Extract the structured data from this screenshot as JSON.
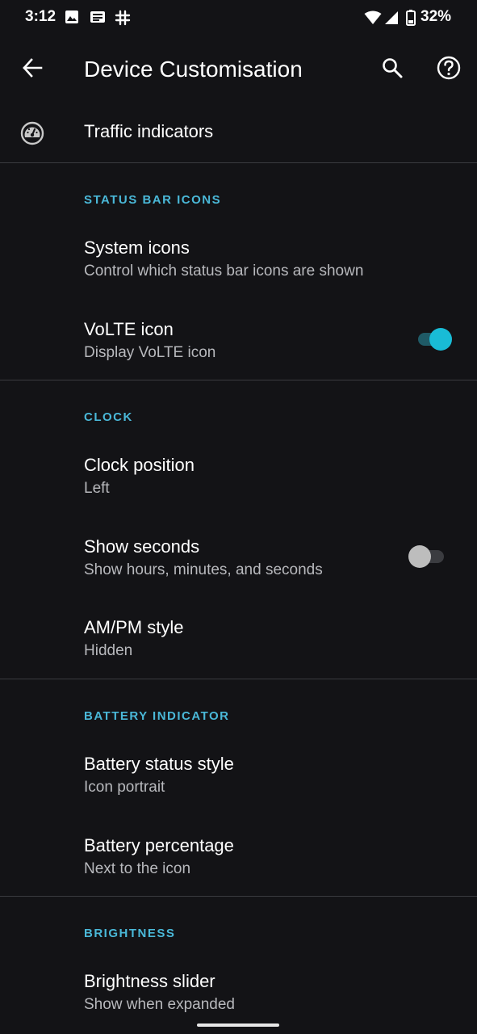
{
  "status_bar": {
    "time": "3:12",
    "left_icons": [
      "image-icon",
      "news-icon",
      "slack-icon"
    ],
    "right_icons": [
      "wifi-icon",
      "signal-icon",
      "battery-icon"
    ],
    "battery_percent": "32%"
  },
  "app_bar": {
    "title": "Device Customisation",
    "back_icon": "arrow-back-icon",
    "search_icon": "search-icon",
    "help_icon": "help-icon"
  },
  "traffic": {
    "title": "Traffic indicators",
    "icon": "speedometer-icon"
  },
  "sections": {
    "status_bar_icons": {
      "header": "STATUS BAR ICONS",
      "system_icons": {
        "title": "System icons",
        "summary": "Control which status bar icons are shown"
      },
      "volte": {
        "title": "VoLTE icon",
        "summary": "Display VoLTE icon",
        "enabled": true
      }
    },
    "clock": {
      "header": "CLOCK",
      "position": {
        "title": "Clock position",
        "summary": "Left"
      },
      "seconds": {
        "title": "Show seconds",
        "summary": "Show hours, minutes, and seconds",
        "enabled": false
      },
      "ampm": {
        "title": "AM/PM style",
        "summary": "Hidden"
      }
    },
    "battery": {
      "header": "BATTERY INDICATOR",
      "style": {
        "title": "Battery status style",
        "summary": "Icon portrait"
      },
      "percentage": {
        "title": "Battery percentage",
        "summary": "Next to the icon"
      }
    },
    "brightness": {
      "header": "BRIGHTNESS",
      "slider": {
        "title": "Brightness slider",
        "summary": "Show when expanded"
      }
    }
  },
  "colors": {
    "background": "#131316",
    "accent": "#4ab8d8",
    "toggle_on": "#19bcd6",
    "divider": "#3a3b3f"
  }
}
